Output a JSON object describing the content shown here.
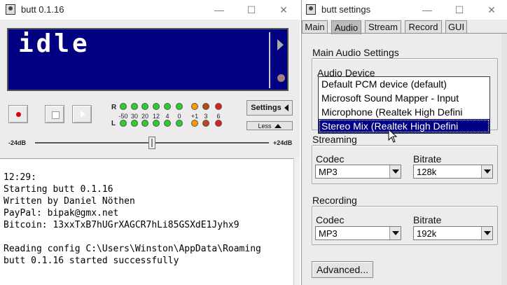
{
  "left_window": {
    "title": "butt 0.1.16",
    "controls": {
      "minimize": "—",
      "maximize": "☐",
      "close": "✕"
    },
    "display": {
      "status": "idle"
    },
    "vu": {
      "channel_r": "R",
      "channel_l": "L",
      "scale": [
        "-50",
        "30",
        "20",
        "12",
        "4",
        "0",
        "+1",
        "3",
        "6"
      ]
    },
    "settings_button": "Settings",
    "less_button": "Less",
    "gain": {
      "min_label": "-24dB",
      "max_label": "+24dB",
      "value_db": 0
    },
    "log": [
      "12:29:",
      "Starting butt 0.1.16",
      "Written by Daniel Nöthen",
      "PayPal: bipak@gmx.net",
      "Bitcoin: 13xxTxB7hUGrXAGCR7hLi85GSXdE1Jyhx9",
      "",
      "Reading config C:\\Users\\Winston\\AppData\\Roaming",
      "butt 0.1.16 started successfully"
    ]
  },
  "right_window": {
    "title": "butt settings",
    "controls": {
      "minimize": "—",
      "maximize": "☐",
      "close": "✕"
    },
    "tabs": [
      {
        "label": "Main",
        "active": false
      },
      {
        "label": "Audio",
        "active": true
      },
      {
        "label": "Stream",
        "active": false
      },
      {
        "label": "Record",
        "active": false
      },
      {
        "label": "GUI",
        "active": false
      }
    ],
    "main_audio": {
      "group_title": "Main Audio Settings",
      "device_label": "Audio Device",
      "device_options": [
        "Default PCM device (default)",
        "Microsoft Sound Mapper - Input",
        "Microphone (Realtek High Defini",
        "Stereo Mix (Realtek High Defini"
      ],
      "device_selected_index": 3
    },
    "streaming": {
      "group_title": "Streaming",
      "codec_label": "Codec",
      "codec_value": "MP3",
      "bitrate_label": "Bitrate",
      "bitrate_value": "128k"
    },
    "recording": {
      "group_title": "Recording",
      "codec_label": "Codec",
      "codec_value": "MP3",
      "bitrate_label": "Bitrate",
      "bitrate_value": "192k"
    },
    "advanced_button": "Advanced..."
  }
}
